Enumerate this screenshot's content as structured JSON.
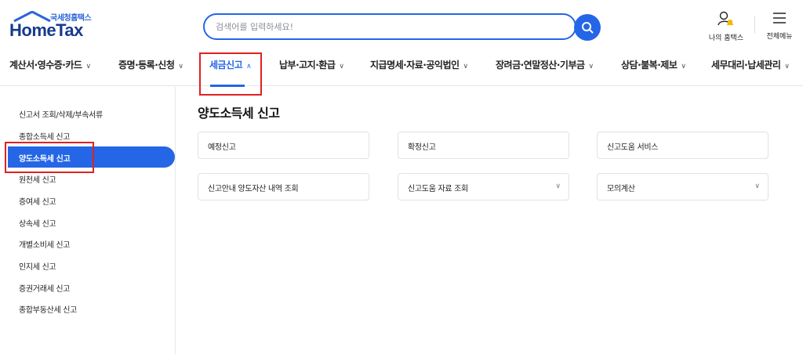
{
  "logo": {
    "sub": "국세청홈택스",
    "main": "HomeTax"
  },
  "search": {
    "placeholder": "검색어를 입력하세요!"
  },
  "utility": {
    "my_hometax": "나의 홈택스",
    "all_menu": "전체메뉴"
  },
  "gnb": {
    "items": [
      {
        "label": "계산서·영수증·카드"
      },
      {
        "label": "증명·등록·신청"
      },
      {
        "label": "세금신고",
        "active": true
      },
      {
        "label": "납부·고지·환급"
      },
      {
        "label": "지급명세·자료·공익법인"
      },
      {
        "label": "장려금·연말정산·기부금"
      },
      {
        "label": "상담·불복·제보"
      },
      {
        "label": "세무대리·납세관리"
      }
    ]
  },
  "sidebar": {
    "items": [
      {
        "label": "신고서 조회/삭제/부속서류"
      },
      {
        "label": "종합소득세 신고"
      },
      {
        "label": "양도소득세 신고",
        "active": true
      },
      {
        "label": "원천세 신고"
      },
      {
        "label": "증여세 신고"
      },
      {
        "label": "상속세 신고"
      },
      {
        "label": "개별소비세 신고"
      },
      {
        "label": "인지세 신고"
      },
      {
        "label": "증권거래세 신고"
      },
      {
        "label": "종합부동산세 신고"
      }
    ]
  },
  "main": {
    "title": "양도소득세 신고",
    "cards": [
      {
        "label": "예정신고",
        "dropdown": false
      },
      {
        "label": "확정신고",
        "dropdown": false
      },
      {
        "label": "신고도움 서비스",
        "dropdown": false
      },
      {
        "label": "신고안내 양도자산 내역 조회",
        "dropdown": false
      },
      {
        "label": "신고도움 자료 조회",
        "dropdown": true
      },
      {
        "label": "모의계산",
        "dropdown": true
      }
    ]
  },
  "colors": {
    "accent": "#2466e6",
    "highlight": "#e02020",
    "logo_dark": "#173a8c"
  }
}
